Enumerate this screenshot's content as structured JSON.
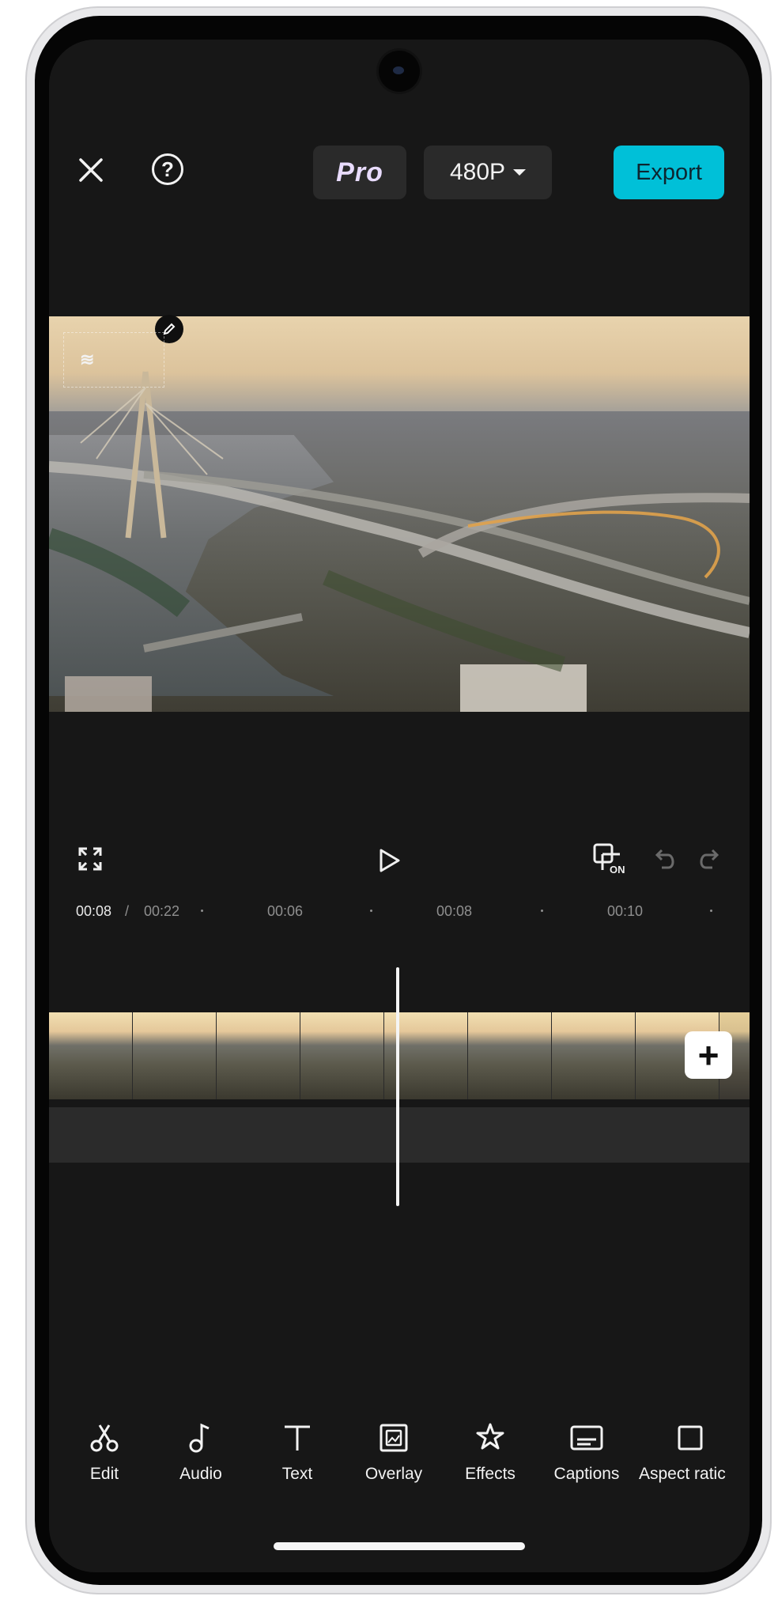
{
  "topbar": {
    "close_icon": "close-icon",
    "help_glyph": "?",
    "pro_label": "Pro",
    "resolution": "480P",
    "export_label": "Export"
  },
  "preview": {
    "edit_badge_icon": "pencil-icon",
    "watermark_text": "≋"
  },
  "playback": {
    "fullscreen_icon": "fullscreen-icon",
    "play_icon": "play-icon",
    "keyframe_icon": "keyframe-on-icon",
    "undo_icon": "undo-icon",
    "redo_icon": "redo-icon"
  },
  "ruler": {
    "current_time": "00:08",
    "separator": "/",
    "total_time": "00:22",
    "ticks": [
      "00:06",
      "00:08",
      "00:10"
    ]
  },
  "timeline": {
    "add_clip_symbol": "+"
  },
  "toolbar": {
    "items": [
      {
        "label": "Edit",
        "icon": "scissors-icon"
      },
      {
        "label": "Audio",
        "icon": "music-note-icon"
      },
      {
        "label": "Text",
        "icon": "text-icon"
      },
      {
        "label": "Overlay",
        "icon": "overlay-icon"
      },
      {
        "label": "Effects",
        "icon": "effects-icon"
      },
      {
        "label": "Captions",
        "icon": "captions-icon"
      },
      {
        "label": "Aspect ratic",
        "icon": "aspect-ratio-icon"
      }
    ]
  },
  "colors": {
    "background": "#171717",
    "export_accent": "#00c0d8",
    "button_bg": "#2a2a2a"
  }
}
